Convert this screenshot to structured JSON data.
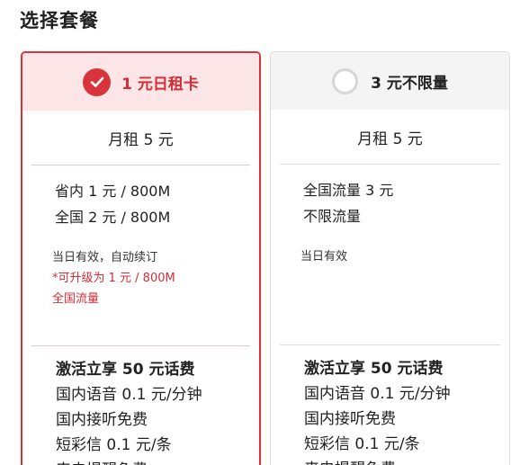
{
  "section_title": "选择套餐",
  "plans": [
    {
      "name": "1 元日租卡",
      "selected": true,
      "price": "月租 5 元",
      "features": [
        "省内 1 元 / 800M",
        "全国 2 元 / 800M"
      ],
      "note": "当日有效，自动续订",
      "note_highlight": [
        "*可升级为 1 元 / 800M",
        "全国流量"
      ],
      "benefits": [
        "激活立享 50 元话费",
        "国内语音 0.1 元/分钟",
        "国内接听免费",
        "短彩信 0.1 元/条",
        "来电提醒免费"
      ]
    },
    {
      "name": "3 元不限量",
      "selected": false,
      "price": "月租 5 元",
      "features": [
        "全国流量 3 元",
        "不限流量"
      ],
      "note": "当日有效",
      "benefits": [
        "激活立享 50 元话费",
        "国内语音 0.1 元/分钟",
        "国内接听免费",
        "短彩信 0.1 元/条",
        "来电提醒免费"
      ]
    }
  ],
  "colors": {
    "accent": "#d9343b",
    "accent_bg": "#fbe5e6",
    "unselected_bg": "#f4f4f4"
  },
  "icons": {
    "selected": "check-circle-icon",
    "unselected": "radio-empty-icon"
  }
}
